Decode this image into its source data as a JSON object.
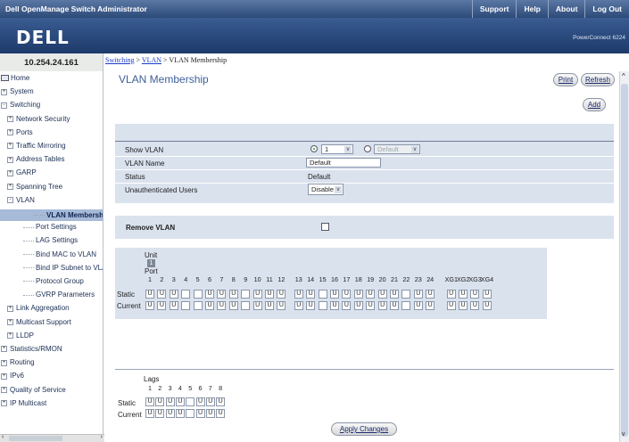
{
  "app": {
    "title": "Dell OpenManage Switch Administrator",
    "top_links": [
      "Support",
      "Help",
      "About",
      "Log Out"
    ],
    "logo_text": "DELL",
    "model": "PowerConnect 6224",
    "ip": "10.254.24.161"
  },
  "breadcrumb": {
    "a": "Switching",
    "b": "VLAN",
    "sep": " > ",
    "current": "VLAN Membership"
  },
  "nav": [
    {
      "label": "Home",
      "depth": 0,
      "icon": "home-icon"
    },
    {
      "label": "System",
      "depth": 0,
      "pm": "+"
    },
    {
      "label": "Switching",
      "depth": 0,
      "pm": "-"
    },
    {
      "label": "Network Security",
      "depth": 1,
      "pm": "+"
    },
    {
      "label": "Ports",
      "depth": 1,
      "pm": "+"
    },
    {
      "label": "Traffic Mirroring",
      "depth": 1,
      "pm": "+"
    },
    {
      "label": "Address Tables",
      "depth": 1,
      "pm": "+"
    },
    {
      "label": "GARP",
      "depth": 1,
      "pm": "+"
    },
    {
      "label": "Spanning Tree",
      "depth": 1,
      "pm": "+"
    },
    {
      "label": "VLAN",
      "depth": 1,
      "pm": "-"
    },
    {
      "label": "VLAN Membership",
      "depth": 2,
      "selected": true
    },
    {
      "label": "Port Settings",
      "depth": 2
    },
    {
      "label": "LAG Settings",
      "depth": 2
    },
    {
      "label": "Bind MAC to VLAN",
      "depth": 2
    },
    {
      "label": "Bind IP Subnet to VLAN",
      "depth": 2
    },
    {
      "label": "Protocol Group",
      "depth": 2
    },
    {
      "label": "GVRP Parameters",
      "depth": 2
    },
    {
      "label": "Link Aggregation",
      "depth": 1,
      "pm": "+"
    },
    {
      "label": "Multicast Support",
      "depth": 1,
      "pm": "+"
    },
    {
      "label": "LLDP",
      "depth": 1,
      "pm": "+"
    },
    {
      "label": "Statistics/RMON",
      "depth": 0,
      "pm": "+"
    },
    {
      "label": "Routing",
      "depth": 0,
      "pm": "+"
    },
    {
      "label": "IPv6",
      "depth": 0,
      "pm": "+"
    },
    {
      "label": "Quality of Service",
      "depth": 0,
      "pm": "+"
    },
    {
      "label": "IP Multicast",
      "depth": 0,
      "pm": "+"
    }
  ],
  "page": {
    "title": "VLAN Membership",
    "print": "Print",
    "refresh": "Refresh",
    "add": "Add",
    "apply": "Apply Changes"
  },
  "form": {
    "show_vlan_label": "Show VLAN",
    "show_vlan_value": "1",
    "show_vlan_name_option": "Default",
    "vlan_name_label": "VLAN Name",
    "vlan_name_value": "Default",
    "status_label": "Status",
    "status_value": "Default",
    "unauth_label": "Unauthenticated Users",
    "unauth_value": "Disable",
    "remove_label": "Remove VLAN"
  },
  "ports": {
    "unit_label": "Unit",
    "unit_value": "1",
    "port_label": "Port",
    "static_label": "Static",
    "current_label": "Current",
    "numbers": [
      "1",
      "2",
      "3",
      "4",
      "5",
      "6",
      "7",
      "8",
      "9",
      "10",
      "11",
      "12",
      "13",
      "14",
      "15",
      "16",
      "17",
      "18",
      "19",
      "20",
      "21",
      "22",
      "23",
      "24",
      "XG1",
      "XG2",
      "XG3",
      "XG4"
    ],
    "static": [
      "U",
      "U",
      "U",
      "",
      "",
      "U",
      "U",
      "U",
      "",
      "U",
      "U",
      "U",
      "U",
      "U",
      "",
      "U",
      "U",
      "U",
      "U",
      "U",
      "U",
      "",
      "U",
      "U",
      "U",
      "U",
      "U",
      "U"
    ],
    "current": [
      "U",
      "U",
      "U",
      "",
      "",
      "U",
      "U",
      "U",
      "",
      "U",
      "U",
      "U",
      "U",
      "U",
      "",
      "U",
      "U",
      "U",
      "U",
      "U",
      "U",
      "",
      "U",
      "U",
      "U",
      "U",
      "U",
      "U"
    ]
  },
  "lags": {
    "label": "Lags",
    "static_label": "Static",
    "current_label": "Current",
    "numbers": [
      "1",
      "2",
      "3",
      "4",
      "5",
      "6",
      "7",
      "8"
    ],
    "static": [
      "U",
      "U",
      "U",
      "U",
      "",
      "U",
      "U",
      "U"
    ],
    "current": [
      "U",
      "U",
      "U",
      "U",
      "",
      "U",
      "U",
      "U"
    ]
  }
}
